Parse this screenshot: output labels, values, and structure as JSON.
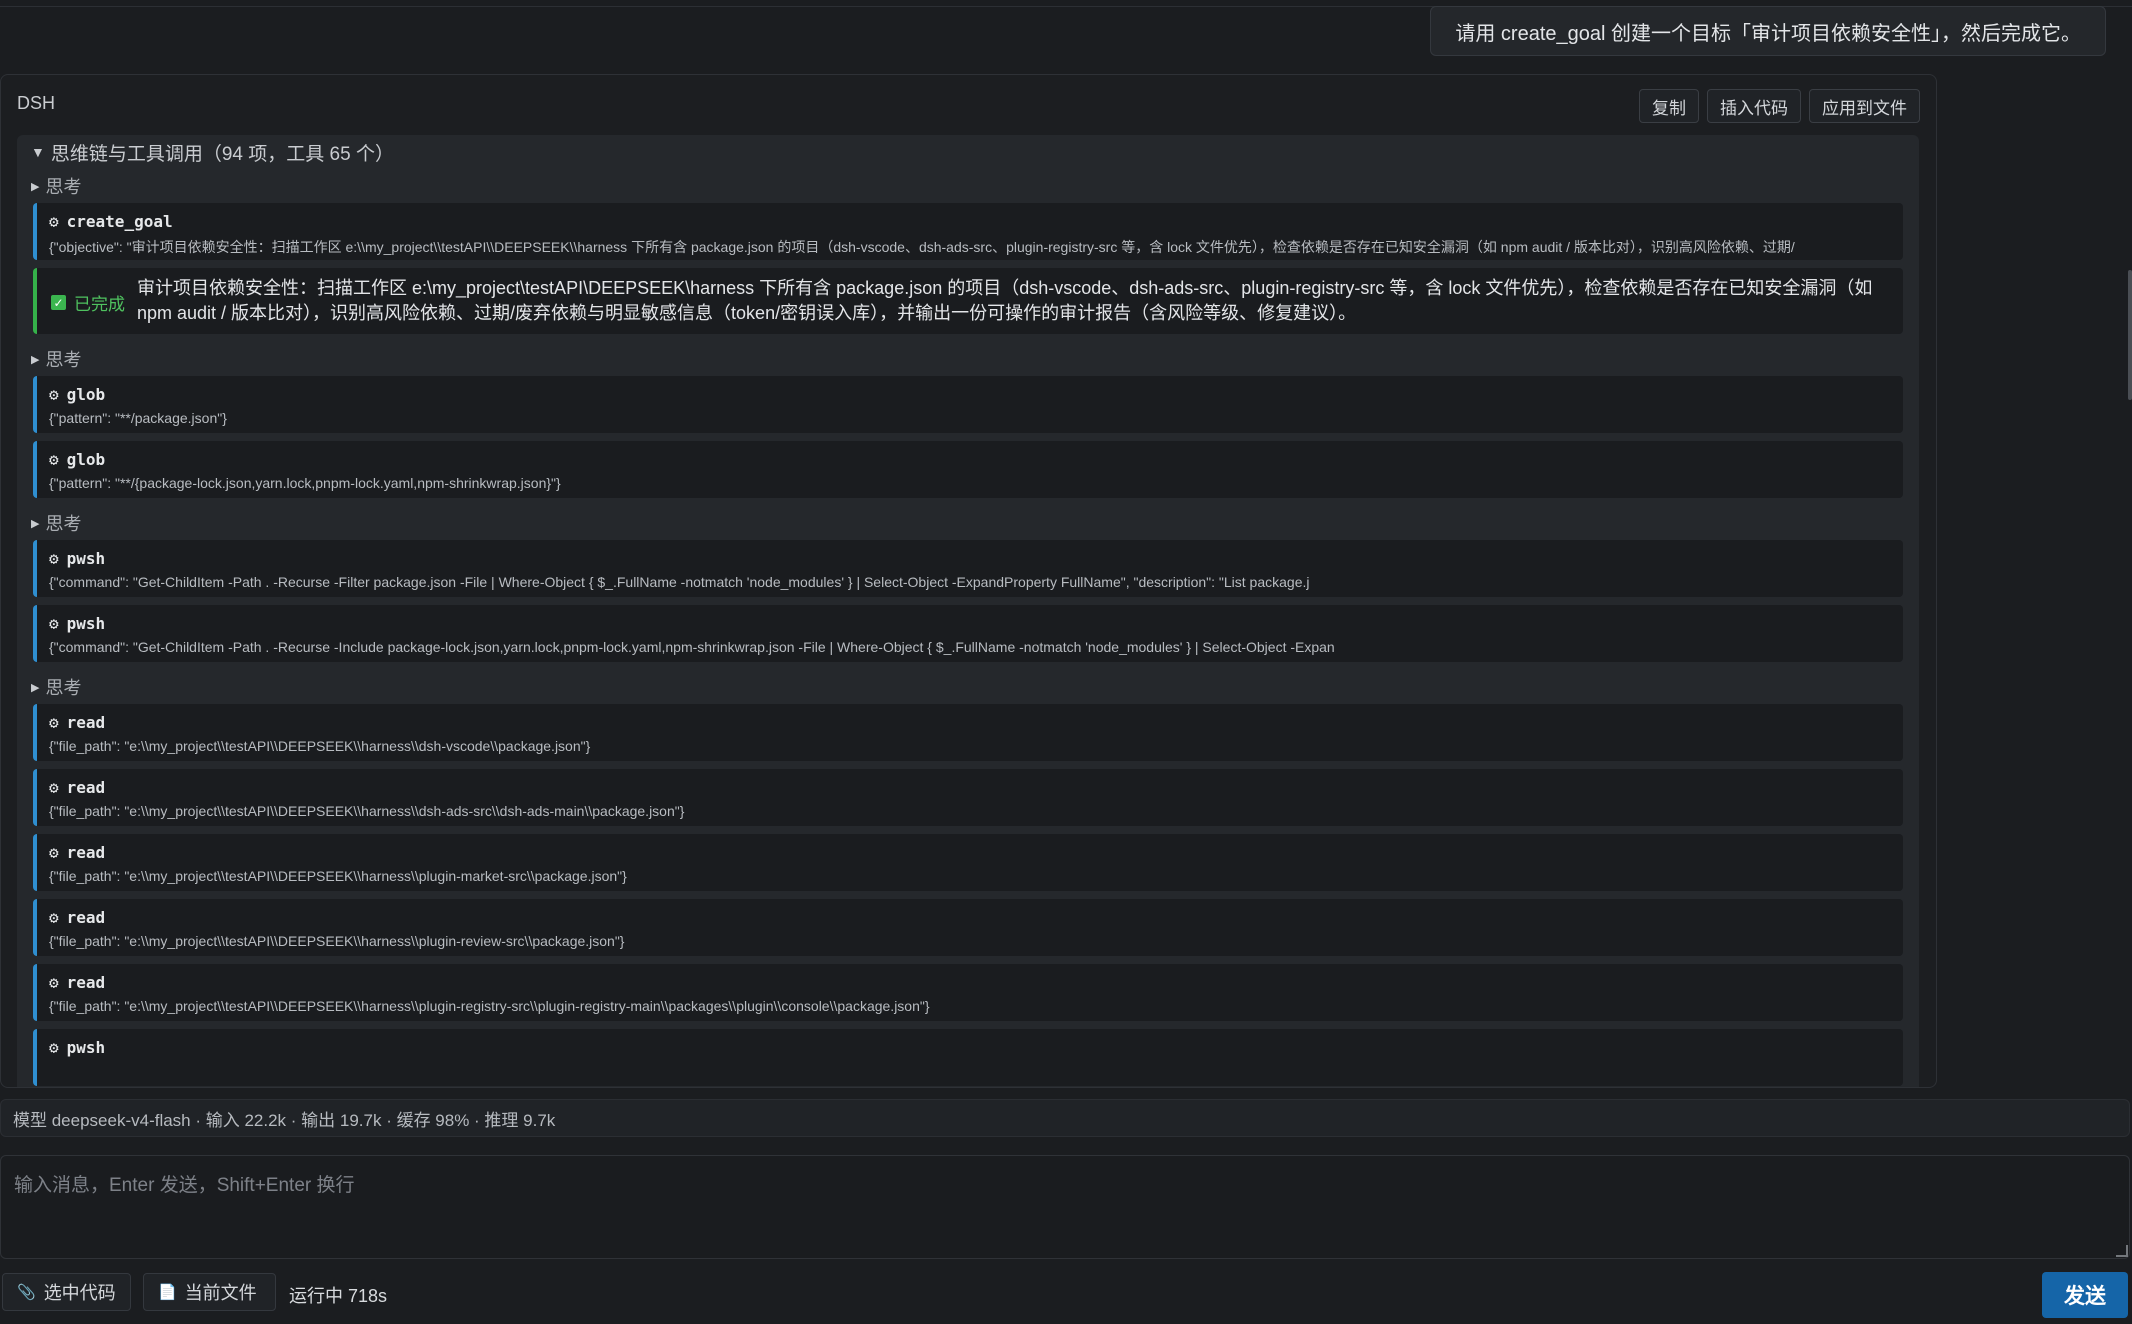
{
  "user_message": "请用 create_goal 创建一个目标「审计项目依赖安全性」，然后完成它。",
  "assistant": {
    "name": "DSH",
    "actions": {
      "copy": "复制",
      "insert_code": "插入代码",
      "apply_to_file": "应用到文件"
    },
    "chain": {
      "summary": "思维链与工具调用（94 项，工具 65 个）",
      "think_label": "思考",
      "items": [
        {
          "tool": "create_goal",
          "args": "{\"objective\": \"审计项目依赖安全性：扫描工作区 e:\\\\my_project\\\\testAPI\\\\DEEPSEEK\\\\harness 下所有含 package.json 的项目（dsh-vscode、dsh-ads-src、plugin-registry-src 等，含 lock 文件优先），检查依赖是否存在已知安全漏洞（如 npm audit / 版本比对），识别高风险依赖、过期/"
        },
        {
          "done_label": "已完成",
          "done_text": "审计项目依赖安全性：扫描工作区 e:\\my_project\\testAPI\\DEEPSEEK\\harness 下所有含 package.json 的项目（dsh-vscode、dsh-ads-src、plugin-registry-src 等，含 lock 文件优先），检查依赖是否存在已知安全漏洞（如 npm audit / 版本比对），识别高风险依赖、过期/废弃依赖与明显敏感信息（token/密钥误入库），并输出一份可操作的审计报告（含风险等级、修复建议）。"
        },
        {
          "tool": "glob",
          "args": "{\"pattern\": \"**/package.json\"}"
        },
        {
          "tool": "glob",
          "args": "{\"pattern\": \"**/{package-lock.json,yarn.lock,pnpm-lock.yaml,npm-shrinkwrap.json}\"}"
        },
        {
          "tool": "pwsh",
          "args": "{\"command\": \"Get-ChildItem -Path . -Recurse -Filter package.json -File | Where-Object { $_.FullName -notmatch 'node_modules' } | Select-Object -ExpandProperty FullName\", \"description\": \"List package.j"
        },
        {
          "tool": "pwsh",
          "args": "{\"command\": \"Get-ChildItem -Path . -Recurse -Include package-lock.json,yarn.lock,pnpm-lock.yaml,npm-shrinkwrap.json -File | Where-Object { $_.FullName -notmatch 'node_modules' } | Select-Object -Expan"
        },
        {
          "tool": "read",
          "args": "{\"file_path\": \"e:\\\\my_project\\\\testAPI\\\\DEEPSEEK\\\\harness\\\\dsh-vscode\\\\package.json\"}"
        },
        {
          "tool": "read",
          "args": "{\"file_path\": \"e:\\\\my_project\\\\testAPI\\\\DEEPSEEK\\\\harness\\\\dsh-ads-src\\\\dsh-ads-main\\\\package.json\"}"
        },
        {
          "tool": "read",
          "args": "{\"file_path\": \"e:\\\\my_project\\\\testAPI\\\\DEEPSEEK\\\\harness\\\\plugin-market-src\\\\package.json\"}"
        },
        {
          "tool": "read",
          "args": "{\"file_path\": \"e:\\\\my_project\\\\testAPI\\\\DEEPSEEK\\\\harness\\\\plugin-review-src\\\\package.json\"}"
        },
        {
          "tool": "read",
          "args": "{\"file_path\": \"e:\\\\my_project\\\\testAPI\\\\DEEPSEEK\\\\harness\\\\plugin-registry-src\\\\plugin-registry-main\\\\packages\\\\plugin\\\\console\\\\package.json\"}"
        },
        {
          "tool": "pwsh",
          "args": ""
        }
      ]
    }
  },
  "status": "模型 deepseek-v4-flash · 输入 22.2k · 输出 19.7k · 缓存 98% · 推理 9.7k",
  "input": {
    "placeholder": "输入消息，Enter 发送，Shift+Enter 换行"
  },
  "footer": {
    "selected_code": "选中代码",
    "current_file": "当前文件",
    "running": "运行中 718s",
    "send": "发送"
  },
  "icons": {
    "tool": "gear-icon",
    "done": "check-icon",
    "attach": "paperclip-icon",
    "file": "file-icon"
  },
  "colors": {
    "accent_tool": "#2f8fd1",
    "accent_done": "#35b24a",
    "send": "#1565a8"
  }
}
